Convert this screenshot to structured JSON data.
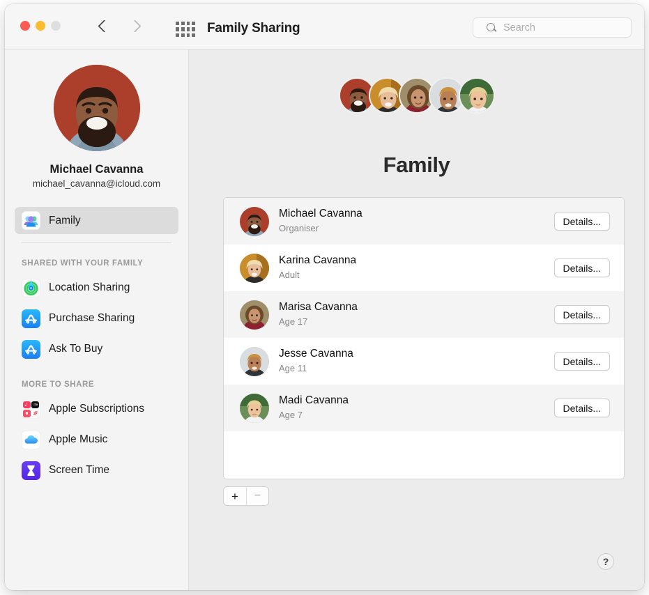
{
  "window": {
    "title": "Family Sharing",
    "traffic_lights": [
      "close",
      "minimize",
      "zoom"
    ],
    "nav": {
      "back": "back-arrow",
      "forward": "forward-arrow",
      "grid": "show-all-grid-icon"
    },
    "search": {
      "placeholder": "Search",
      "value": ""
    }
  },
  "sidebar": {
    "profile": {
      "name": "Michael Cavanna",
      "email": "michael_cavanna@icloud.com",
      "avatar_icon": "user-avatar"
    },
    "primary": [
      {
        "label": "Family",
        "icon": "family-icon",
        "selected": true
      }
    ],
    "groups": [
      {
        "heading": "SHARED WITH YOUR FAMILY",
        "items": [
          {
            "label": "Location Sharing",
            "icon": "find-my-icon"
          },
          {
            "label": "Purchase Sharing",
            "icon": "app-store-icon"
          },
          {
            "label": "Ask To Buy",
            "icon": "app-store-icon"
          }
        ]
      },
      {
        "heading": "MORE TO SHARE",
        "items": [
          {
            "label": "Apple Subscriptions",
            "icon": "apple-subscriptions-icon"
          },
          {
            "label": "Apple Music",
            "icon": "icloud-icon"
          },
          {
            "label": "Screen Time",
            "icon": "screen-time-icon"
          }
        ]
      }
    ]
  },
  "main": {
    "title": "Family",
    "avatar_cluster": [
      "michael-avatar",
      "karina-avatar",
      "marisa-avatar",
      "jesse-avatar",
      "madi-avatar"
    ],
    "members": [
      {
        "name": "Michael Cavanna",
        "role": "Organiser",
        "button": "Details...",
        "avatar": "michael-avatar"
      },
      {
        "name": "Karina Cavanna",
        "role": "Adult",
        "button": "Details...",
        "avatar": "karina-avatar"
      },
      {
        "name": "Marisa Cavanna",
        "role": "Age 17",
        "button": "Details...",
        "avatar": "marisa-avatar"
      },
      {
        "name": "Jesse Cavanna",
        "role": "Age 11",
        "button": "Details...",
        "avatar": "jesse-avatar"
      },
      {
        "name": "Madi Cavanna",
        "role": "Age 7",
        "button": "Details...",
        "avatar": "madi-avatar"
      }
    ],
    "add_button": "+",
    "remove_button": "−",
    "help_button": "?"
  },
  "colors": {
    "window_bg": "#ececec",
    "sidebar_bg": "#f4f4f4",
    "titlebar_bg": "#f6f6f6",
    "selection": "#dcdcdc",
    "row_alt": "#f4f4f4",
    "traffic_red": "#fb5b52",
    "traffic_yellow": "#fbbb2e",
    "traffic_gray": "#dedede",
    "app_store_blue": "#1a7ef4",
    "find_my_green": "#34c759",
    "screen_time_purple": "#5426e8"
  }
}
